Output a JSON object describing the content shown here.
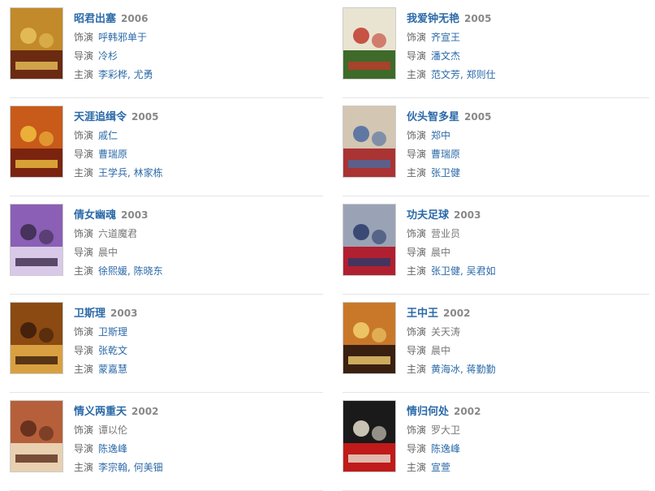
{
  "labels": {
    "role": "饰演",
    "director": "导演",
    "cast": "主演"
  },
  "items": [
    {
      "title": "昭君出塞",
      "year": "2006",
      "role": "呼韩邪单于",
      "role_link": true,
      "director": "冷杉",
      "director_link": true,
      "cast": [
        "李彩桦",
        "尤勇"
      ],
      "colors": [
        "#c28a2a",
        "#6b2a12",
        "#e8c25a"
      ]
    },
    {
      "title": "我爱钟无艳",
      "year": "2005",
      "role": "齐宣王",
      "role_link": true,
      "director": "潘文杰",
      "director_link": true,
      "cast": [
        "范文芳",
        "郑则仕"
      ],
      "colors": [
        "#e9e4d2",
        "#3e6a2a",
        "#c0392b"
      ]
    },
    {
      "title": "天涯追缉令",
      "year": "2005",
      "role": "戚仁",
      "role_link": true,
      "director": "曹瑞原",
      "director_link": true,
      "cast": [
        "王学兵",
        "林家栋"
      ],
      "colors": [
        "#c85a1a",
        "#7a2410",
        "#f0c040"
      ]
    },
    {
      "title": "伙头智多星",
      "year": "2005",
      "role": "郑中",
      "role_link": true,
      "director": "曹瑞原",
      "director_link": true,
      "cast": [
        "张卫健"
      ],
      "colors": [
        "#d3c6b3",
        "#a33",
        "#4a6aa0"
      ]
    },
    {
      "title": "倩女幽魂",
      "year": "2003",
      "role": "六道魔君",
      "role_link": false,
      "director": "晨中",
      "director_link": false,
      "cast": [
        "徐熙媛",
        "陈晓东"
      ],
      "colors": [
        "#8a5fb5",
        "#d9c8e8",
        "#3a2a4a"
      ]
    },
    {
      "title": "功夫足球",
      "year": "2003",
      "role": "营业员",
      "role_link": false,
      "director": "晨中",
      "director_link": false,
      "cast": [
        "张卫健",
        "吴君如"
      ],
      "colors": [
        "#9aa3b5",
        "#b02030",
        "#2a3a6a"
      ]
    },
    {
      "title": "卫斯理",
      "year": "2003",
      "role": "卫斯理",
      "role_link": true,
      "director": "张乾文",
      "director_link": true,
      "cast": [
        "蒙嘉慧"
      ],
      "colors": [
        "#8a4a12",
        "#d8a040",
        "#3a1a0a"
      ]
    },
    {
      "title": "王中王",
      "year": "2002",
      "role": "关天涛",
      "role_link": false,
      "director": "晨中",
      "director_link": false,
      "cast": [
        "黄海冰",
        "蒋勤勤"
      ],
      "colors": [
        "#c9782a",
        "#3a2010",
        "#f2d070"
      ]
    },
    {
      "title": "情义两重天",
      "year": "2002",
      "role": "谭以伦",
      "role_link": false,
      "director": "陈逸峰",
      "director_link": true,
      "cast": [
        "李宗翰",
        "何美钿"
      ],
      "colors": [
        "#b5603a",
        "#e8d0b0",
        "#5a2a1a"
      ]
    },
    {
      "title": "情归何处",
      "year": "2002",
      "role": "罗大卫",
      "role_link": false,
      "director": "陈逸峰",
      "director_link": true,
      "cast": [
        "宣萱"
      ],
      "colors": [
        "#1a1a1a",
        "#c01a1a",
        "#e8e0d0"
      ]
    }
  ]
}
